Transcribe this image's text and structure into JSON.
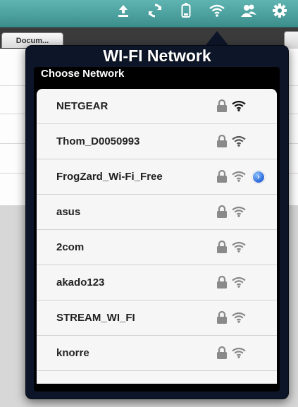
{
  "toolbar": {
    "icons": [
      "upload-icon",
      "sync-icon",
      "battery-icon",
      "wifi-icon",
      "contacts-icon",
      "gear-icon"
    ]
  },
  "tabs": {
    "document_tab_label": "Docum..."
  },
  "popover": {
    "title": "WI-FI Network",
    "section_label": "Choose Network",
    "networks": [
      {
        "name": "NETGEAR",
        "locked": true,
        "signal": "strong",
        "has_detail": false
      },
      {
        "name": "Thom_D0050993",
        "locked": true,
        "signal": "medium",
        "has_detail": false
      },
      {
        "name": "FrogZard_Wi-Fi_Free",
        "locked": true,
        "signal": "weak",
        "has_detail": true
      },
      {
        "name": "asus",
        "locked": true,
        "signal": "weak",
        "has_detail": false
      },
      {
        "name": "2com",
        "locked": true,
        "signal": "weak",
        "has_detail": false
      },
      {
        "name": "akado123",
        "locked": true,
        "signal": "weak",
        "has_detail": false
      },
      {
        "name": "STREAM_WI_FI",
        "locked": true,
        "signal": "weak",
        "has_detail": false
      },
      {
        "name": "knorre",
        "locked": true,
        "signal": "weak",
        "has_detail": false
      }
    ]
  },
  "colors": {
    "topbar": "#4aa3a0",
    "popover_bg": "#0d1629",
    "list_bg": "#f6f6f6",
    "info_button": "#2a67d8"
  }
}
